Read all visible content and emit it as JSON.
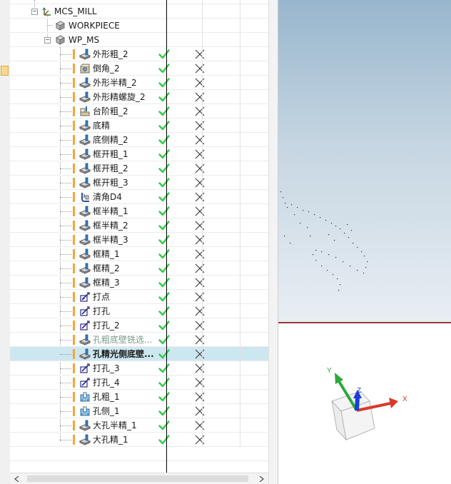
{
  "tree": {
    "partial_top_label": "...",
    "geometry_nodes": [
      {
        "name": "MCS_MILL",
        "icon": "mcs-coordinate-icon"
      },
      {
        "name": "WORKPIECE",
        "icon": "workpiece-icon"
      },
      {
        "name": "WP_MS",
        "icon": "workpiece-icon"
      }
    ],
    "operations": [
      {
        "name": "外形粗_2",
        "icon": "cavity-mill-icon"
      },
      {
        "name": "倒角_2",
        "icon": "chamfer-icon"
      },
      {
        "name": "外形半精_2",
        "icon": "cavity-mill-icon"
      },
      {
        "name": "外形精螺旋_2",
        "icon": "cavity-mill-icon"
      },
      {
        "name": "台阶粗_2",
        "icon": "step-mill-icon"
      },
      {
        "name": "底精",
        "icon": "floor-wall-icon"
      },
      {
        "name": "底侧精_2",
        "icon": "floor-wall-icon"
      },
      {
        "name": "框开粗_1",
        "icon": "cavity-mill-icon"
      },
      {
        "name": "框开粗_2",
        "icon": "cavity-mill-icon"
      },
      {
        "name": "框开粗_3",
        "icon": "cavity-mill-icon"
      },
      {
        "name": "清角D4",
        "icon": "corner-cleanup-icon"
      },
      {
        "name": "框半精_1",
        "icon": "cavity-mill-icon"
      },
      {
        "name": "框半精_2",
        "icon": "cavity-mill-icon"
      },
      {
        "name": "框半精_3",
        "icon": "cavity-mill-icon"
      },
      {
        "name": "框精_1",
        "icon": "cavity-mill-icon"
      },
      {
        "name": "框精_2",
        "icon": "cavity-mill-icon"
      },
      {
        "name": "框精_3",
        "icon": "cavity-mill-icon"
      },
      {
        "name": "打点",
        "icon": "spot-drill-icon"
      },
      {
        "name": "打孔",
        "icon": "drill-icon"
      },
      {
        "name": "打孔_2",
        "icon": "drill-icon"
      },
      {
        "name": "孔粗底壁铣选...",
        "icon": "floor-wall-icon",
        "style": "greyed"
      },
      {
        "name": "孔精光侧底壁...",
        "icon": "floor-wall-icon",
        "style": "bold",
        "selected": true
      },
      {
        "name": "打孔_3",
        "icon": "drill-icon"
      },
      {
        "name": "打孔_4",
        "icon": "drill-icon"
      },
      {
        "name": "孔粗_1",
        "icon": "hole-mill-icon"
      },
      {
        "name": "孔侧_1",
        "icon": "hole-mill-icon"
      },
      {
        "name": "大孔半精_1",
        "icon": "cavity-mill-icon"
      },
      {
        "name": "大孔精_1",
        "icon": "cavity-mill-icon"
      }
    ]
  },
  "status_icons": {
    "path": "check-icon",
    "toolpath": "cross-icon"
  },
  "triad": {
    "x": "X",
    "y": "Y",
    "z": "Z"
  },
  "colors": {
    "check": "#2ecc40",
    "orange_marker": "#f5a43a",
    "selected_row": "#cde7f0",
    "greyed_text": "#7a9a86",
    "axis_x": "#d83a2a",
    "axis_y": "#2ca83a",
    "axis_z": "#1a3ed6"
  }
}
